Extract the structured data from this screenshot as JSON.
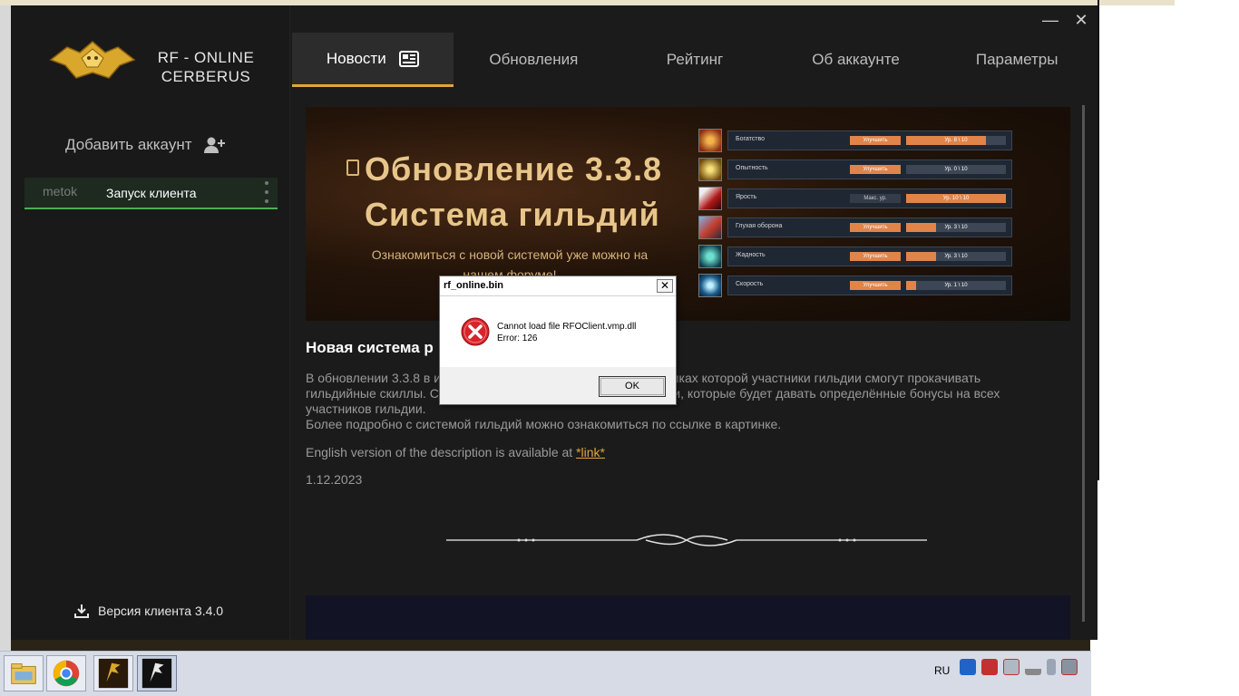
{
  "app": {
    "logo_line1": "RF - ONLINE",
    "logo_line2": "CERBERUS",
    "window_controls": {
      "minimize": "—",
      "close": "✕"
    }
  },
  "tabs": [
    {
      "label": "Новости",
      "active": true
    },
    {
      "label": "Обновления"
    },
    {
      "label": "Рейтинг"
    },
    {
      "label": "Об аккаунте"
    },
    {
      "label": "Параметры"
    }
  ],
  "sidebar": {
    "add_account_label": "Добавить аккаунт",
    "account_name": "metok",
    "launch_label": "Запуск клиента",
    "version_label": "Версия клиента 3.4.0"
  },
  "banner": {
    "title_line1": "Обновление 3.3.8",
    "title_line2": "Система гильдий",
    "subtitle": "Ознакомиться с новой системой уже можно на нашем форуме!",
    "skills": [
      {
        "name": "Богатство",
        "button": "Улучшить",
        "level": "Ур. 8 \\ 10",
        "fill": 0.8
      },
      {
        "name": "Опытность",
        "button": "Улучшить",
        "level": "Ур. 0 \\ 10",
        "fill": 0.0
      },
      {
        "name": "Ярость",
        "button": "Макс. ур.",
        "level": "Ур. 10 \\ 10",
        "fill": 1.0
      },
      {
        "name": "Глухая оборона",
        "button": "Улучшить",
        "level": "Ур. 3 \\ 10",
        "fill": 0.3
      },
      {
        "name": "Жадность",
        "button": "Улучшить",
        "level": "Ур. 3 \\ 10",
        "fill": 0.3
      },
      {
        "name": "Скорость",
        "button": "Улучшить",
        "level": "Ур. 1 \\ 10",
        "fill": 0.1
      }
    ]
  },
  "news": {
    "title": "Новая система р",
    "body_line1": "В обновлении 3.3.8 в и                                                             рамках которой участники гильдии смогут прокачивать",
    "body_line2": "гильдийные скиллы. С                                                            иями, которые будет давать определённые бонусы на всех",
    "body_line3": "участников гильдии.",
    "body_line4": "Более подробно с системой гильдий можно ознакомиться по ссылке в картинке.",
    "english_text": "English version of the description is available at ",
    "english_link": "*link*",
    "date": "1.12.2023"
  },
  "dialog": {
    "title": "rf_online.bin",
    "close": "✕",
    "message_line1": "Cannot load file RFOClient.vmp.dll",
    "message_line2": "Error: 126",
    "ok_label": "OK"
  },
  "taskbar": {
    "lang": "RU"
  },
  "colors": {
    "accent": "#e0a73a",
    "account_active": "#4caf50",
    "skill_orange": "#e0844a",
    "error_red": "#d8232a"
  }
}
